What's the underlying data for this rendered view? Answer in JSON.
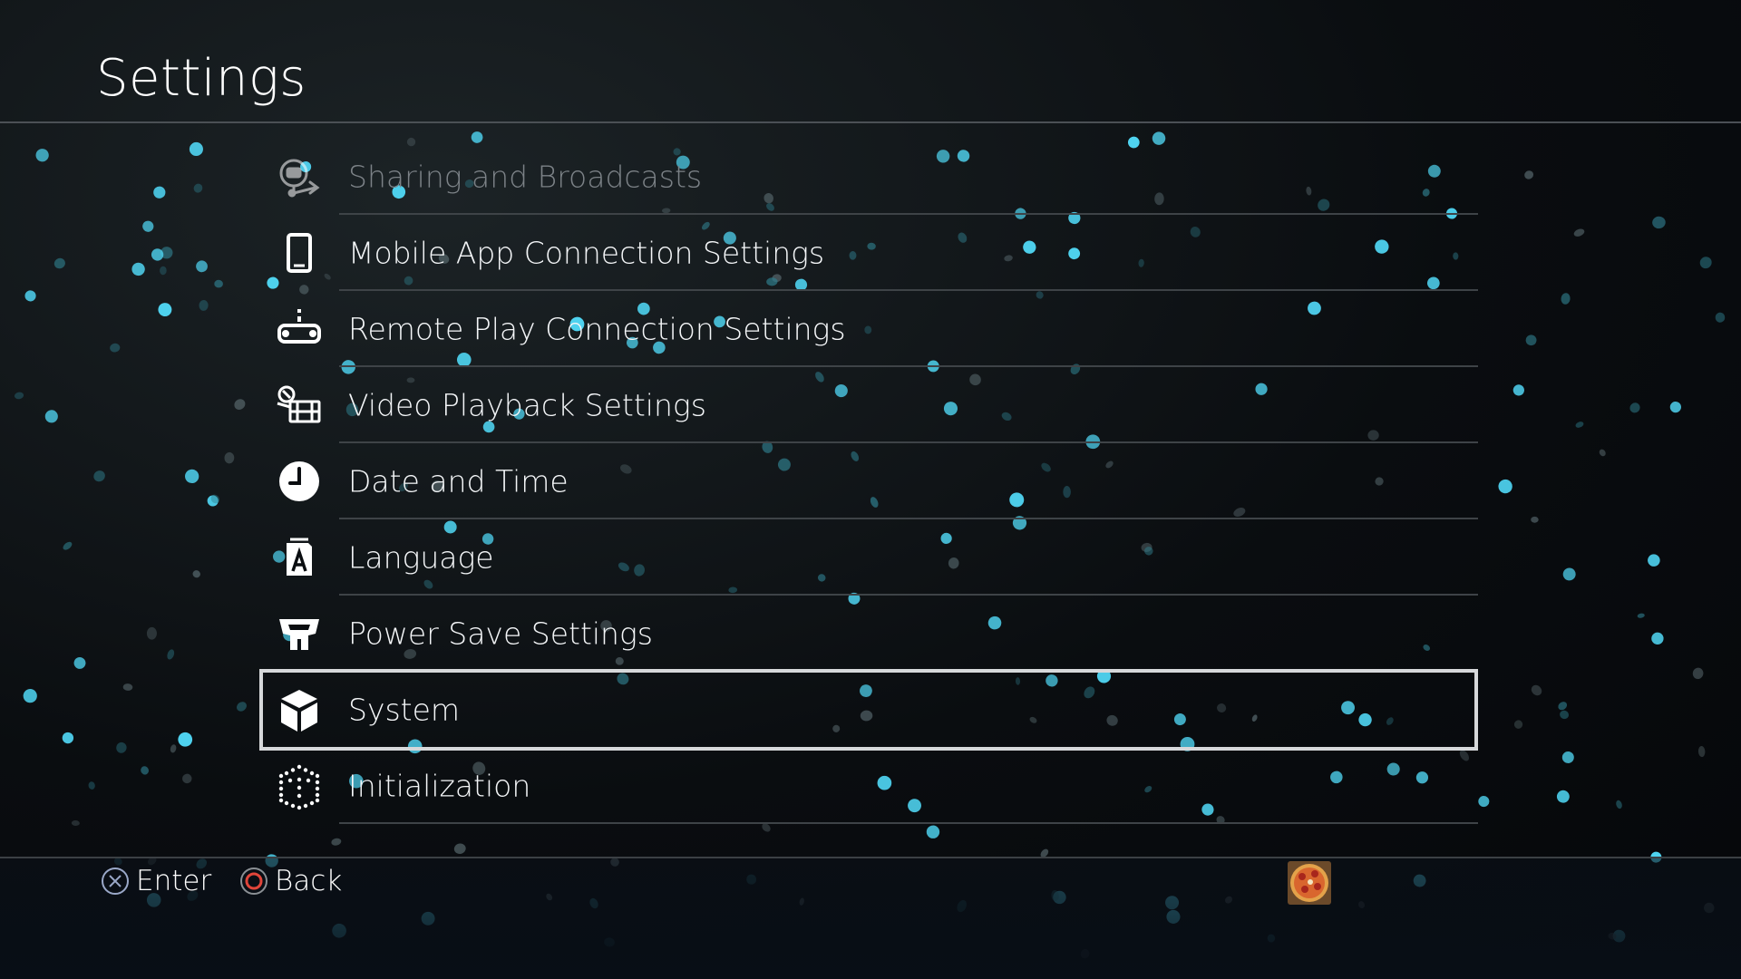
{
  "header": {
    "title": "Settings"
  },
  "menu": {
    "items": [
      {
        "label": "Sharing and Broadcasts",
        "icon": "sharing-broadcast-icon",
        "state": "faded"
      },
      {
        "label": "Mobile App Connection Settings",
        "icon": "mobile-device-icon",
        "state": "normal"
      },
      {
        "label": "Remote Play Connection Settings",
        "icon": "remote-play-icon",
        "state": "normal"
      },
      {
        "label": "Video Playback Settings",
        "icon": "video-playback-icon",
        "state": "normal"
      },
      {
        "label": "Date and Time",
        "icon": "clock-icon",
        "state": "normal"
      },
      {
        "label": "Language",
        "icon": "language-icon",
        "state": "normal"
      },
      {
        "label": "Power Save Settings",
        "icon": "power-save-icon",
        "state": "normal"
      },
      {
        "label": "System",
        "icon": "system-cube-icon",
        "state": "selected"
      },
      {
        "label": "Initialization",
        "icon": "initialization-icon",
        "state": "normal"
      }
    ]
  },
  "footer": {
    "enter_label": "Enter",
    "enter_icon": "cross-button-icon",
    "back_label": "Back",
    "back_icon": "circle-button-icon",
    "avatar_icon": "user-avatar-pizza"
  },
  "colors": {
    "background": "#0a0d10",
    "accent_particle": "#4fd3f0",
    "cross_button": "#9aa8c8",
    "circle_button": "#e0453a",
    "selection_border": "#d6d8da",
    "divider": "#3e4347"
  }
}
